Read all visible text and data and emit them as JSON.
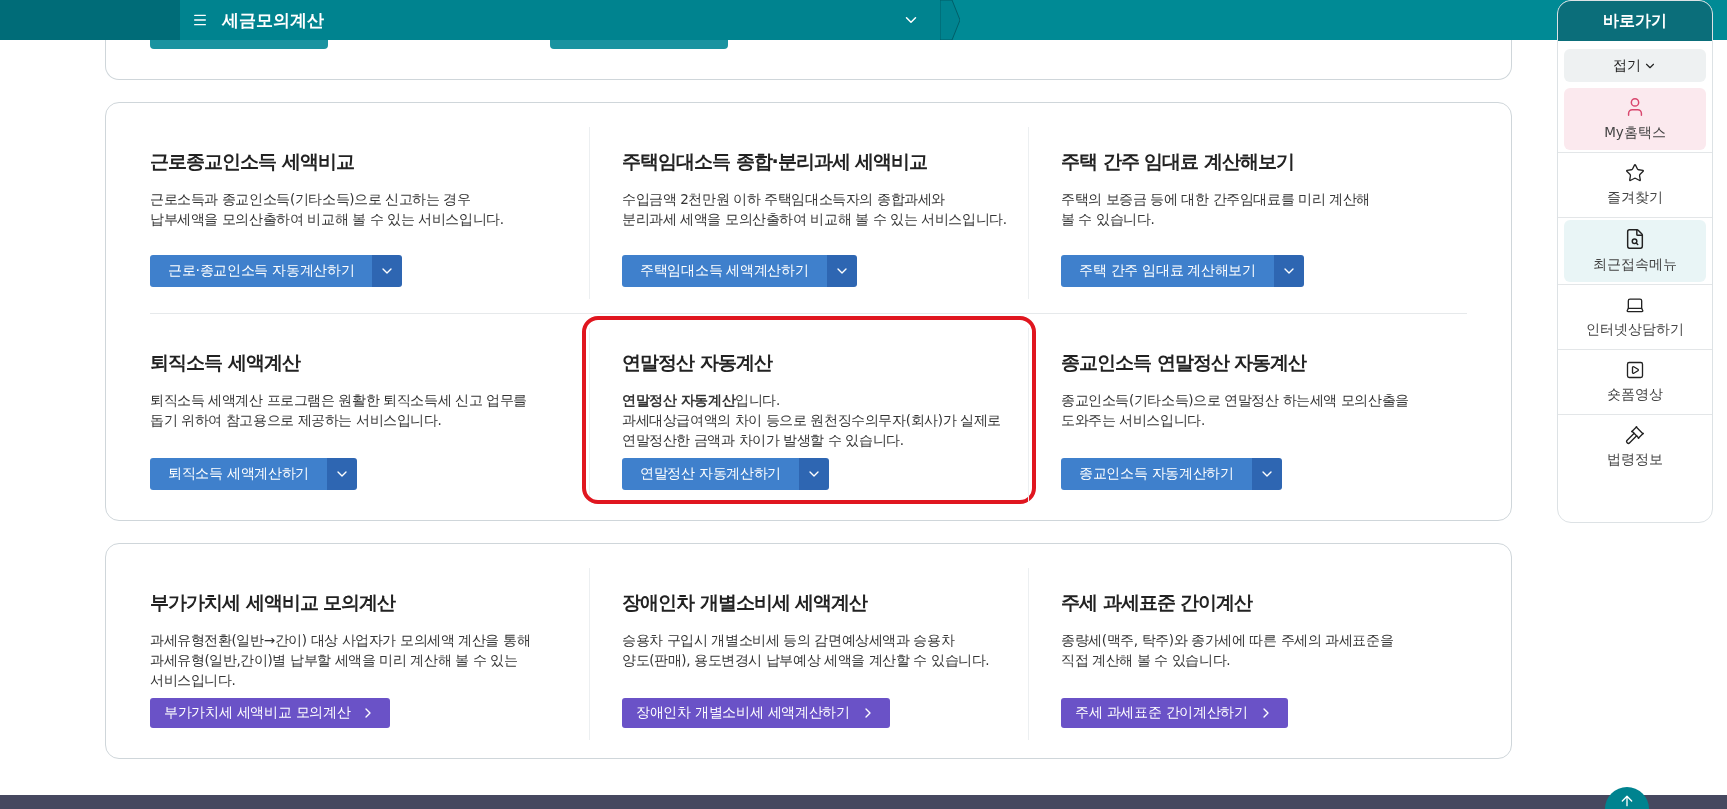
{
  "top_bar": {
    "menu_title": "세금모의계산"
  },
  "quick_menu": {
    "title": "바로가기",
    "collapse": "접기",
    "items": [
      {
        "label": "My홈택스",
        "color": "#fbe9ee"
      },
      {
        "label": "즐겨찾기",
        "color": "#ffffff"
      },
      {
        "label": "최근접속메뉴",
        "color": "#e9f5f6"
      },
      {
        "label": "인터넷상담하기",
        "color": "#ffffff"
      },
      {
        "label": "숏폼영상",
        "color": "#ffffff"
      },
      {
        "label": "법령정보",
        "color": "#ffffff"
      }
    ]
  },
  "sections": [
    {
      "rows": [
        [
          {
            "title": "근로종교인소득 세액비교",
            "description": "근로소득과 종교인소득(기타소득)으로 신고하는 경우\n납부세액을 모의산출하여 비교해 볼 수 있는 서비스입니다.",
            "button": "근로·종교인소득 자동계산하기",
            "kind": "split",
            "highlighted": false
          },
          {
            "title": "주택임대소득 종합·분리과세 세액비교",
            "description": "수입금액 2천만원 이하 주택임대소득자의 종합과세와\n분리과세 세액을 모의산출하여 비교해 볼 수 있는 서비스입니다.",
            "button": "주택임대소득 세액계산하기",
            "kind": "split",
            "highlighted": false
          },
          {
            "title": "주택 간주 임대료 계산해보기",
            "description": "주택의 보증금 등에 대한 간주임대료를 미리 계산해\n볼 수 있습니다.",
            "button": "주택 간주 임대료 계산해보기",
            "kind": "split",
            "highlighted": false
          }
        ],
        [
          {
            "title": "퇴직소득 세액계산",
            "description": "퇴직소득 세액계산 프로그램은 원활한 퇴직소득세 신고 업무를\n돕기 위하여 참고용으로 제공하는 서비스입니다.",
            "button": "퇴직소득 세액계산하기",
            "kind": "split",
            "highlighted": false
          },
          {
            "title": "연말정산 자동계산",
            "description": "**연말정산 자동계산**입니다.\n과세대상급여액의 차이 등으로 원천징수의무자(회사)가 실제로\n연말정산한 금액과 차이가 발생할 수 있습니다.",
            "button": "연말정산 자동계산하기",
            "kind": "split",
            "highlighted": true
          },
          {
            "title": "종교인소득 연말정산 자동계산",
            "description": "종교인소득(기타소득)으로 연말정산 하는세액 모의산출을\n도와주는 서비스입니다.",
            "button": "종교인소득 자동계산하기",
            "kind": "split",
            "highlighted": false
          }
        ]
      ]
    },
    {
      "rows": [
        [
          {
            "title": "부가가치세 세액비교 모의계산",
            "description": "과세유형전환(일반→간이) 대상 사업자가 모의세액 계산을 통해\n과세유형(일반,간이)별 납부할 세액을 미리 계산해 볼 수 있는\n서비스입니다.",
            "button": "부가가치세 세액비교 모의계산",
            "kind": "arrow",
            "highlighted": false
          },
          {
            "title": "장애인차 개별소비세 세액계산",
            "description": "승용차 구입시 개별소비세 등의 감면예상세액과 승용차\n양도(판매), 용도변경시 납부예상 세액을 계산할 수 있습니다.",
            "button": "장애인차 개별소비세 세액계산하기",
            "kind": "arrow",
            "highlighted": false
          },
          {
            "title": "주세 과세표준 간이계산",
            "description": "종량세(맥주, 탁주)와 종가세에 따른 주세의 과세표준을\n직접 계산해 볼 수 있습니다.",
            "button": "주세 과세표준 간이계산하기",
            "kind": "arrow",
            "highlighted": false
          }
        ]
      ]
    }
  ]
}
